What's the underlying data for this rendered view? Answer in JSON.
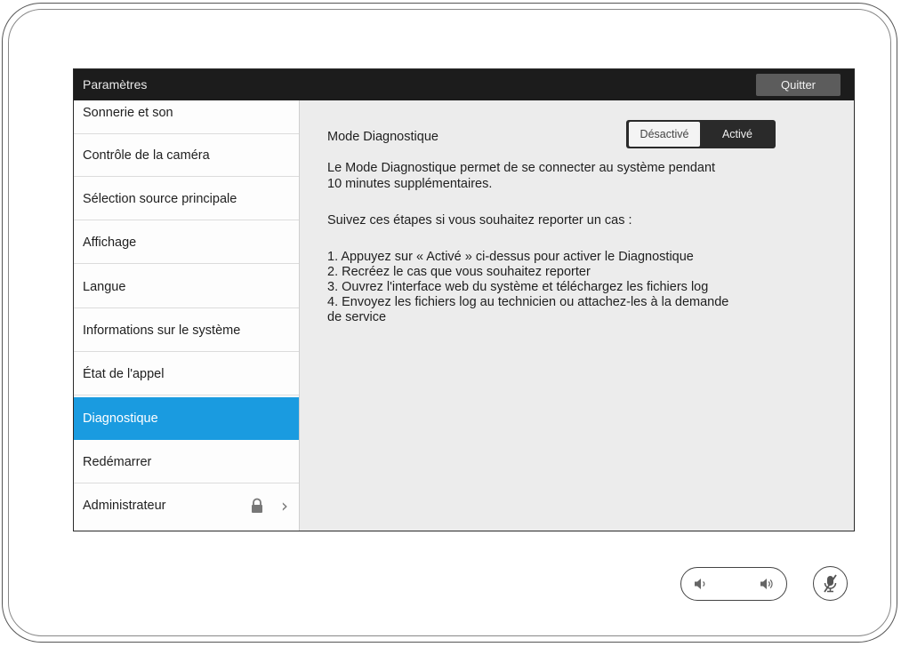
{
  "titlebar": {
    "title": "Paramètres",
    "quit_label": "Quitter"
  },
  "sidebar": {
    "items": [
      {
        "label": "Sonnerie et son"
      },
      {
        "label": "Contrôle de la caméra"
      },
      {
        "label": "Sélection source principale"
      },
      {
        "label": "Affichage"
      },
      {
        "label": "Langue"
      },
      {
        "label": "Informations sur le système"
      },
      {
        "label": "État de l'appel"
      },
      {
        "label": "Diagnostique",
        "selected": true
      },
      {
        "label": "Redémarrer"
      },
      {
        "label": "Administrateur",
        "icons": [
          "lock-icon",
          "chevron-right-icon"
        ]
      }
    ]
  },
  "content": {
    "mode_label": "Mode Diagnostique",
    "toggle": {
      "off_label": "Désactivé",
      "on_label": "Activé"
    },
    "intro_line1": "Le Mode Diagnostique permet de se connecter au système pendant",
    "intro_line2": "10 minutes supplémentaires.",
    "steps_heading": "Suivez ces étapes si vous souhaitez reporter un cas :",
    "step1": "1. Appuyez sur « Activé » ci-dessus pour activer le Diagnostique",
    "step2": "2. Recréez le cas que vous souhaitez reporter",
    "step3": "3. Ouvrez l'interface web du système et téléchargez les fichiers log",
    "step4_line1": "4. Envoyez les fichiers log au technicien ou attachez-les à la demande",
    "step4_line2": "de service"
  },
  "footer": {
    "volume_icons": [
      "volume-down-icon",
      "volume-up-icon"
    ],
    "mute_icon": "microphone-muted-icon"
  },
  "colors": {
    "titlebar": "#1c1c1c",
    "selected": "#1a9be0",
    "content_bg": "#ececec"
  }
}
